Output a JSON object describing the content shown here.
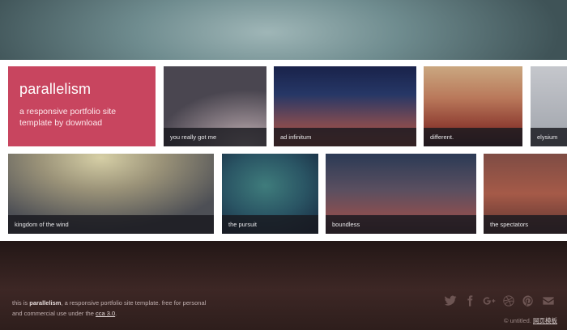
{
  "hero": {
    "title": "parallelism",
    "subtitle": "a responsive portfolio site template by download"
  },
  "tiles": [
    {
      "caption": "you really got me"
    },
    {
      "caption": "ad infinitum"
    },
    {
      "caption": "different."
    },
    {
      "caption": "elysium"
    },
    {
      "caption": "kingdom of the wind"
    },
    {
      "caption": "the pursuit"
    },
    {
      "caption": "boundless"
    },
    {
      "caption": "the spectators"
    }
  ],
  "footer": {
    "prefix": "this is ",
    "brand": "parallelism",
    "middle": ", a responsive portfolio site template. free for personal and commercial use under the ",
    "license_link": "cca 3.0",
    "suffix": ".",
    "credit_prefix": "© untitled. ",
    "credit_link": "网页模板"
  },
  "social": [
    "twitter-icon",
    "facebook-icon",
    "google-plus-icon",
    "dribbble-icon",
    "pinterest-icon",
    "email-icon"
  ],
  "colors": {
    "hero_accent": "#c8455f",
    "caption_bg": "#19191e",
    "footer_bg": "#2e1e1c"
  }
}
